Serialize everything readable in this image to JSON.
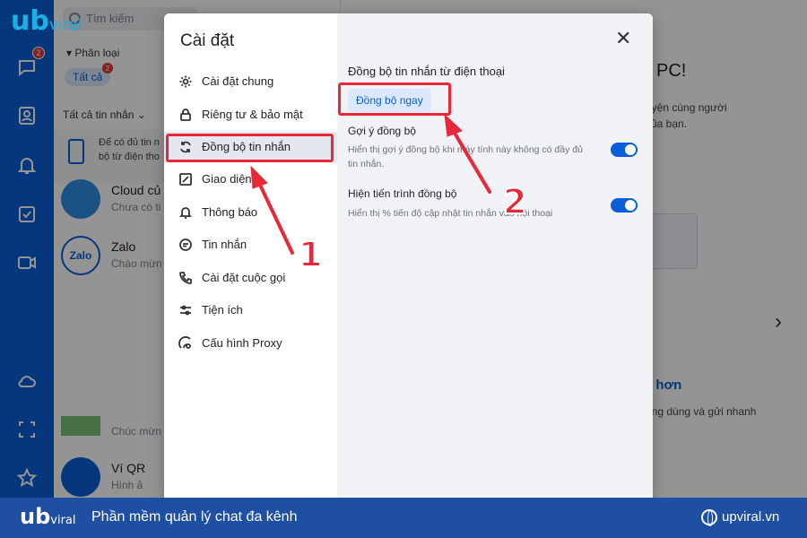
{
  "brand": {
    "logo": "ub",
    "logo_suffix": "viral"
  },
  "sidebar": {
    "chat_badge": "2",
    "icons": [
      "chat-icon",
      "contacts-icon",
      "bell-icon",
      "todo-icon",
      "video-icon",
      "cloud-icon",
      "screenshot-icon",
      "star-icon"
    ]
  },
  "chat_list": {
    "search_placeholder": "Tìm kiếm",
    "filter_label": "Phân loại",
    "all_pill": "Tất cả",
    "all_pill_badge": "2",
    "all_messages": "Tất cả tin nhắn",
    "sync_hint_line1": "Để có đủ tin n",
    "sync_hint_line2": "bộ từ điện tho",
    "rows": [
      {
        "name": "Cloud củ",
        "preview": "Chưa có ti"
      },
      {
        "name": "Zalo",
        "preview": "Chào mừn"
      },
      {
        "name": "",
        "preview": "Chúc mừn"
      },
      {
        "name": "Ví QR",
        "preview": "Hình ả"
      }
    ]
  },
  "welcome": {
    "title": "PC!",
    "line1": "uyện cùng người",
    "line2": "của bạn.",
    "link": "ít hơn",
    "link_desc": "ụng dùng và gửi nhanh"
  },
  "settings_modal": {
    "title": "Cài đặt",
    "close_label": "✕",
    "nav": [
      {
        "label": "Cài đặt chung",
        "icon": "gear-icon"
      },
      {
        "label": "Riêng tư & bảo mật",
        "icon": "lock-icon"
      },
      {
        "label": "Đồng bộ tin nhắn",
        "icon": "sync-icon",
        "active": true
      },
      {
        "label": "Giao diện",
        "icon": "palette-icon"
      },
      {
        "label": "Thông báo",
        "icon": "bell-icon"
      },
      {
        "label": "Tin nhắn",
        "icon": "message-icon"
      },
      {
        "label": "Cài đặt cuộc gọi",
        "icon": "phone-icon"
      },
      {
        "label": "Tiện ích",
        "icon": "sliders-icon"
      },
      {
        "label": "Cấu hình Proxy",
        "icon": "proxy-icon"
      }
    ],
    "section_title": "Đồng bộ tin nhắn từ điện thoại",
    "sync_now_button": "Đồng bộ ngay",
    "options": [
      {
        "title": "Gợi ý đồng bộ",
        "desc": "Hiển thị gợi ý đồng bộ khi máy tính này không có đầy đủ tin nhắn.",
        "enabled": true
      },
      {
        "title": "Hiện tiến trình đồng bộ",
        "desc": "Hiển thị % tiến độ cập nhật tin nhắn vào hội thoại",
        "enabled": true
      }
    ]
  },
  "annotations": {
    "step1": "1",
    "step2": "2",
    "color": "#e8283a"
  },
  "footer": {
    "logo": "ub",
    "logo_suffix": "viral",
    "tagline": "Phần mềm quản lý chat đa kênh",
    "site": "upviral.vn",
    "bg_color": "#1f4fa3"
  }
}
